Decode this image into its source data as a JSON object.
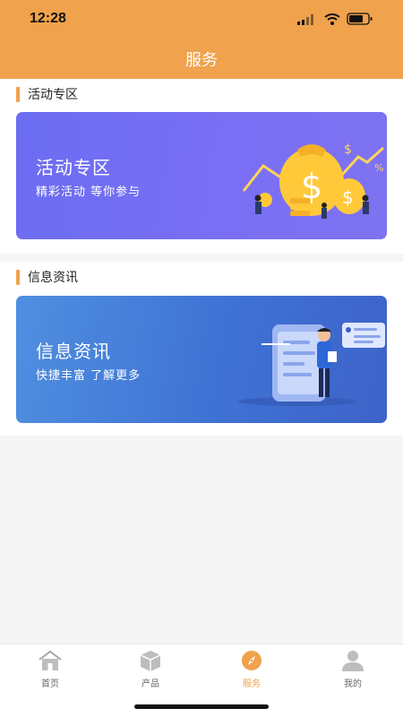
{
  "status_bar": {
    "time": "12:28"
  },
  "header": {
    "title": "服务"
  },
  "sections": [
    {
      "title": "活动专区",
      "card_title": "活动专区",
      "card_subtitle": "精彩活动 等你参与"
    },
    {
      "title": "信息资讯",
      "card_title": "信息资讯",
      "card_subtitle": "快捷丰富 了解更多"
    }
  ],
  "tabbar": {
    "items": [
      {
        "label": "首页",
        "icon": "home-icon"
      },
      {
        "label": "产品",
        "icon": "box-icon"
      },
      {
        "label": "服务",
        "icon": "compass-icon"
      },
      {
        "label": "我的",
        "icon": "user-icon"
      }
    ],
    "active_index": 2
  },
  "colors": {
    "accent": "#f0a24c",
    "card1": "#7170f3",
    "card2": "#4678d6"
  }
}
